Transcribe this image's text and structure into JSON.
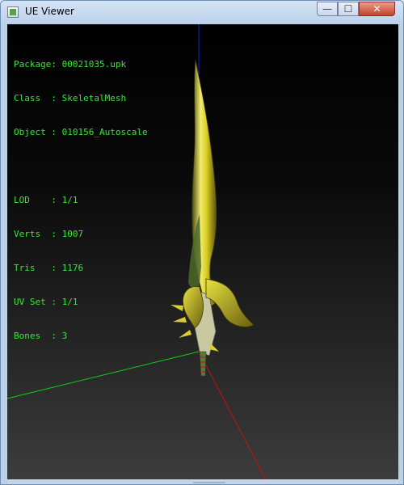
{
  "window": {
    "title": "UE Viewer"
  },
  "controls": {
    "minimize": "—",
    "maximize": "☐",
    "close": "✕"
  },
  "info": {
    "package": {
      "label": "Package",
      "sep": ": ",
      "value": "00021035.upk"
    },
    "class": {
      "label": "Class  ",
      "sep": ": ",
      "value": "SkeletalMesh"
    },
    "object": {
      "label": "Object ",
      "sep": ": ",
      "value": "010156_Autoscale"
    },
    "lod": {
      "label": "LOD    ",
      "sep": ": ",
      "value": "1/1"
    },
    "verts": {
      "label": "Verts  ",
      "sep": ": ",
      "value": "1007"
    },
    "tris": {
      "label": "Tris   ",
      "sep": ": ",
      "value": "1176"
    },
    "uvset": {
      "label": "UV Set ",
      "sep": ": ",
      "value": "1/1"
    },
    "bones": {
      "label": "Bones  ",
      "sep": ": ",
      "value": "3"
    }
  },
  "colors": {
    "info_text": "#39e639",
    "axis_x": "#c81010",
    "axis_y": "#10d010",
    "axis_z": "#1020e0",
    "blade": "#d8d020"
  },
  "icons": {
    "app": "app-icon"
  }
}
